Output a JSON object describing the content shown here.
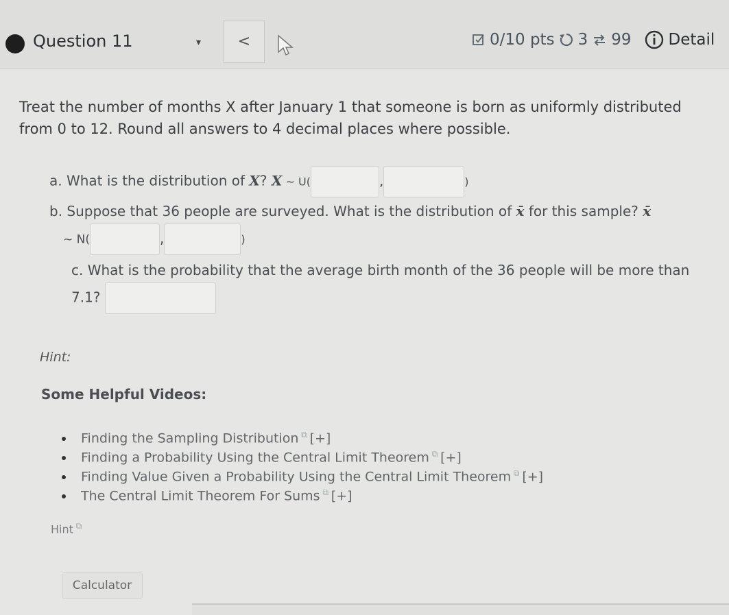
{
  "header": {
    "question_label": "Question 11",
    "dropdown_arrow": "▾",
    "prev_label": "<",
    "points": "0/10 pts",
    "attempts": "3",
    "submissions": "99",
    "details": "Detail"
  },
  "question": {
    "intro_line1": "Treat the number of months X after January 1 that someone is born as uniformly distributed",
    "intro_line2": "from 0 to 12. Round all answers to 4 decimal places where possible.",
    "a_text": "a. What is the distribution of",
    "a_var": "X",
    "a_q": "?",
    "a_dist_prefix": "X",
    "a_tilde": " ~ U(",
    "a_comma": ",",
    "a_close": ")",
    "b_text": "b. Suppose that 36 people are surveyed.  What is the distribution of",
    "b_var": "x̄",
    "b_text2": "for this sample?",
    "b_var2": "x̄",
    "b_tilde": "~ N(",
    "b_comma": ",",
    "b_close": ")",
    "c_text": "c. What is the probability that the average birth month of the 36 people will be more than",
    "c_value": "7.1?"
  },
  "hint_label": "Hint:",
  "videos": {
    "heading": "Some Helpful Videos:",
    "items": [
      {
        "label": "Finding the Sampling Distribution",
        "expand": "[+]"
      },
      {
        "label": "Finding a Probability Using the Central Limit Theorem",
        "expand": "[+]"
      },
      {
        "label": "Finding Value Given a Probability Using the Central Limit Theorem",
        "expand": "[+]"
      },
      {
        "label": "The Central Limit Theorem For Sums",
        "expand": "[+]"
      }
    ]
  },
  "hint_link": "Hint",
  "calculator_label": "Calculator",
  "icons": {
    "bullet": "bullet-icon",
    "external": "external-link-icon"
  }
}
